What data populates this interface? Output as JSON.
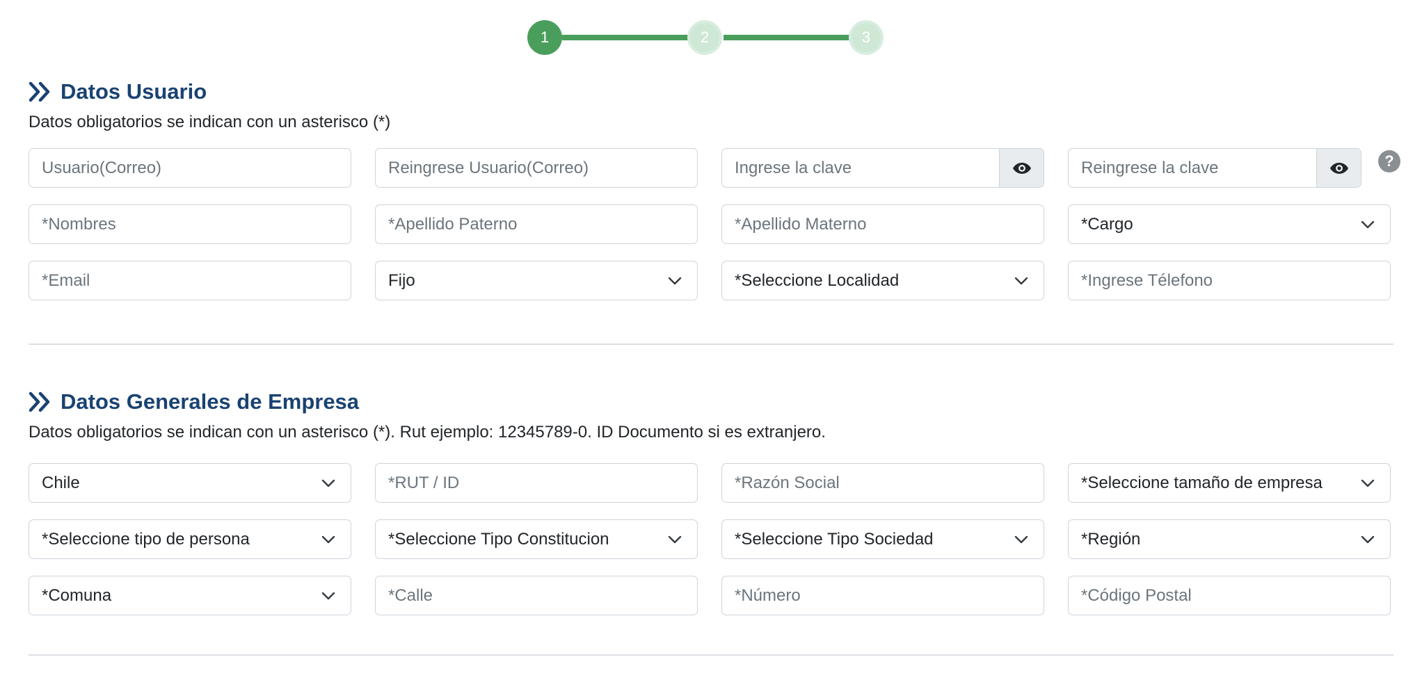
{
  "stepper": {
    "steps": [
      "1",
      "2",
      "3"
    ],
    "active_step": 1,
    "colors": {
      "active": "#4a9e5c",
      "inactive": "#cfe8d6",
      "line": "#4a9e5c"
    }
  },
  "usuario": {
    "title": "Datos Usuario",
    "note": "Datos obligatorios se indican con un asterisco (*)",
    "usuario_placeholder": "Usuario(Correo)",
    "reingrese_usuario_placeholder": "Reingrese Usuario(Correo)",
    "clave_placeholder": "Ingrese la clave",
    "reingrese_clave_placeholder": "Reingrese la clave",
    "nombres_placeholder": "*Nombres",
    "apellido_paterno_placeholder": "*Apellido Paterno",
    "apellido_materno_placeholder": "*Apellido Materno",
    "cargo_selected": "*Cargo",
    "email_placeholder": "*Email",
    "tipo_telefono_selected": "Fijo",
    "localidad_selected": "*Seleccione Localidad",
    "telefono_placeholder": "*Ingrese Télefono",
    "help_icon": "?"
  },
  "empresa": {
    "title": "Datos Generales de Empresa",
    "note": "Datos obligatorios se indican con un asterisco (*). Rut ejemplo: 12345789-0. ID Documento si es extranjero.",
    "pais_selected": "Chile",
    "rut_placeholder": "*RUT / ID",
    "razon_social_placeholder": "*Razón Social",
    "tamano_selected": "*Seleccione tamaño de empresa",
    "tipo_persona_selected": "*Seleccione tipo de persona",
    "tipo_constitucion_selected": "*Seleccione Tipo Constitucion",
    "tipo_sociedad_selected": "*Seleccione Tipo Sociedad",
    "region_selected": "*Región",
    "comuna_selected": "*Comuna",
    "calle_placeholder": "*Calle",
    "numero_placeholder": "*Número",
    "codigo_postal_placeholder": "*Código Postal"
  },
  "theme": {
    "title_color": "#1a4272",
    "border_color": "#ced4da",
    "placeholder_color": "#6c757d"
  }
}
